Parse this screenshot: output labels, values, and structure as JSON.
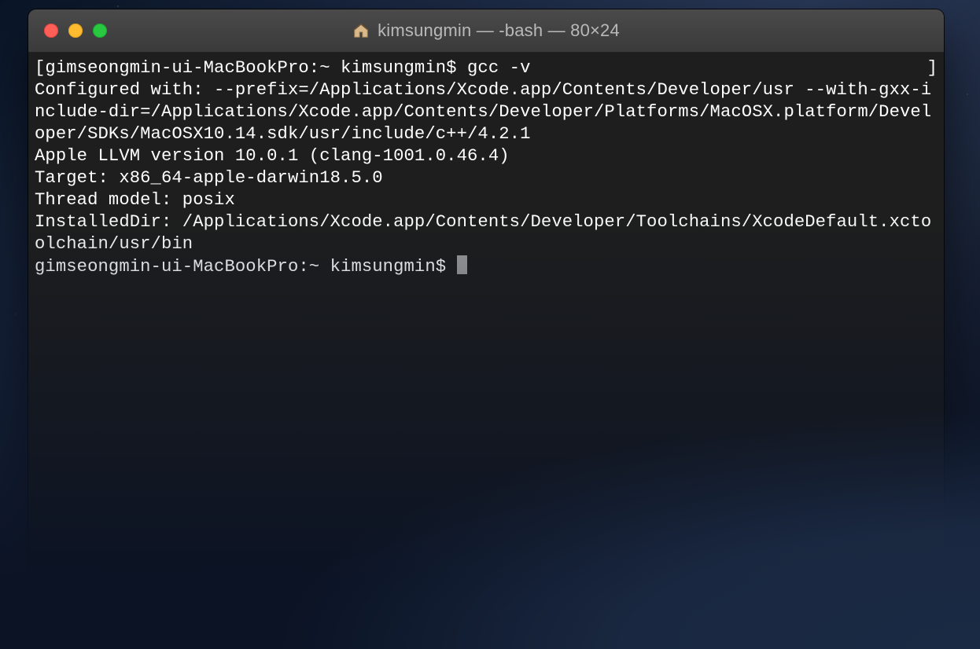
{
  "window": {
    "title": "kimsungmin — -bash — 80×24",
    "controls": {
      "close": "close-button",
      "minimize": "minimize-button",
      "maximize": "maximize-button"
    },
    "icon": "home-folder-icon"
  },
  "terminal": {
    "row1_left": "[gimseongmin-ui-MacBookPro:~ kimsungmin$ gcc -v",
    "row1_right": "]",
    "output_lines": [
      "Configured with: --prefix=/Applications/Xcode.app/Contents/Developer/usr --with-gxx-include-dir=/Applications/Xcode.app/Contents/Developer/Platforms/MacOSX.platform/Developer/SDKs/MacOSX10.14.sdk/usr/include/c++/4.2.1",
      "Apple LLVM version 10.0.1 (clang-1001.0.46.4)",
      "Target: x86_64-apple-darwin18.5.0",
      "Thread model: posix",
      "InstalledDir: /Applications/Xcode.app/Contents/Developer/Toolchains/XcodeDefault.xctoolchain/usr/bin"
    ],
    "prompt2": "gimseongmin-ui-MacBookPro:~ kimsungmin$ "
  },
  "colors": {
    "window_bg": "#1e1e1e",
    "titlebar_from": "#4a4a4a",
    "titlebar_to": "#3a3a3a",
    "text": "#ffffff",
    "title_text": "#b9b9b9",
    "close": "#ff5f57",
    "minimize": "#febc2e",
    "maximize": "#28c840",
    "cursor": "#9f9f9f"
  }
}
